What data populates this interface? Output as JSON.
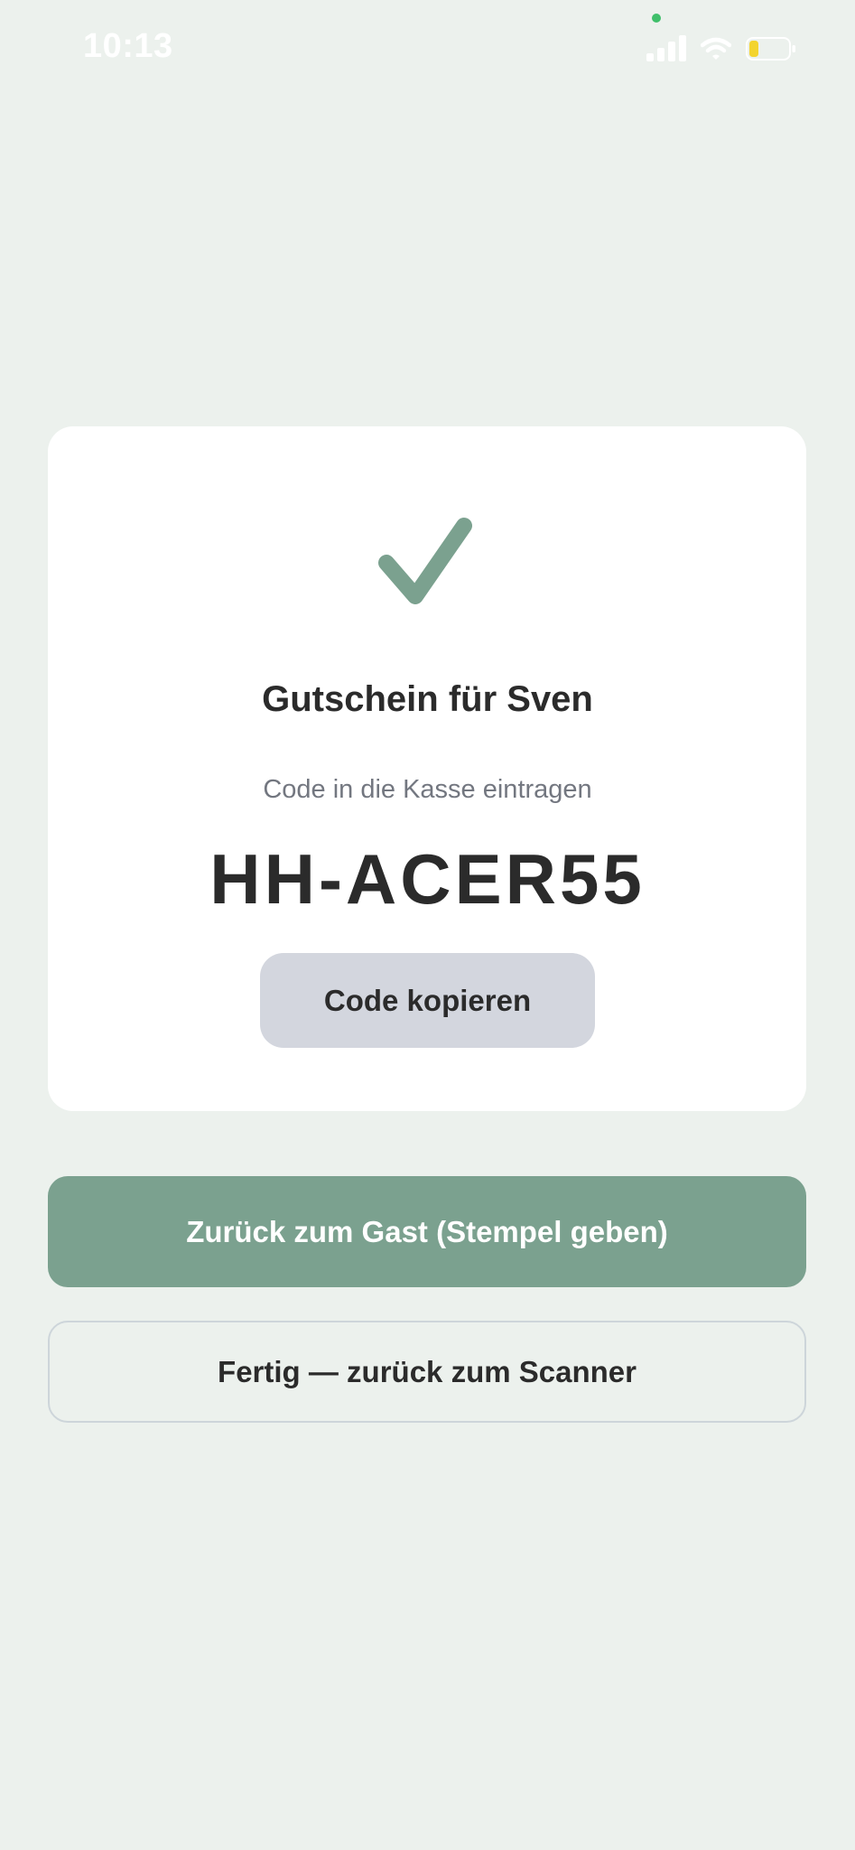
{
  "status_bar": {
    "time": "10:13"
  },
  "voucher": {
    "icon": "checkmark-icon",
    "title": "Gutschein für Sven",
    "subtitle": "Code in die Kasse eintragen",
    "code": "HH-ACER55",
    "copy_label": "Code kopieren"
  },
  "actions": {
    "primary_label": "Zurück zum Gast (Stempel geben)",
    "secondary_label": "Fertig — zurück zum Scanner"
  },
  "colors": {
    "background": "#ecf1ed",
    "accent": "#7ba18f",
    "card": "#ffffff",
    "copy_button": "#d3d6de",
    "text": "#2b2b2b",
    "muted_text": "#737780"
  }
}
